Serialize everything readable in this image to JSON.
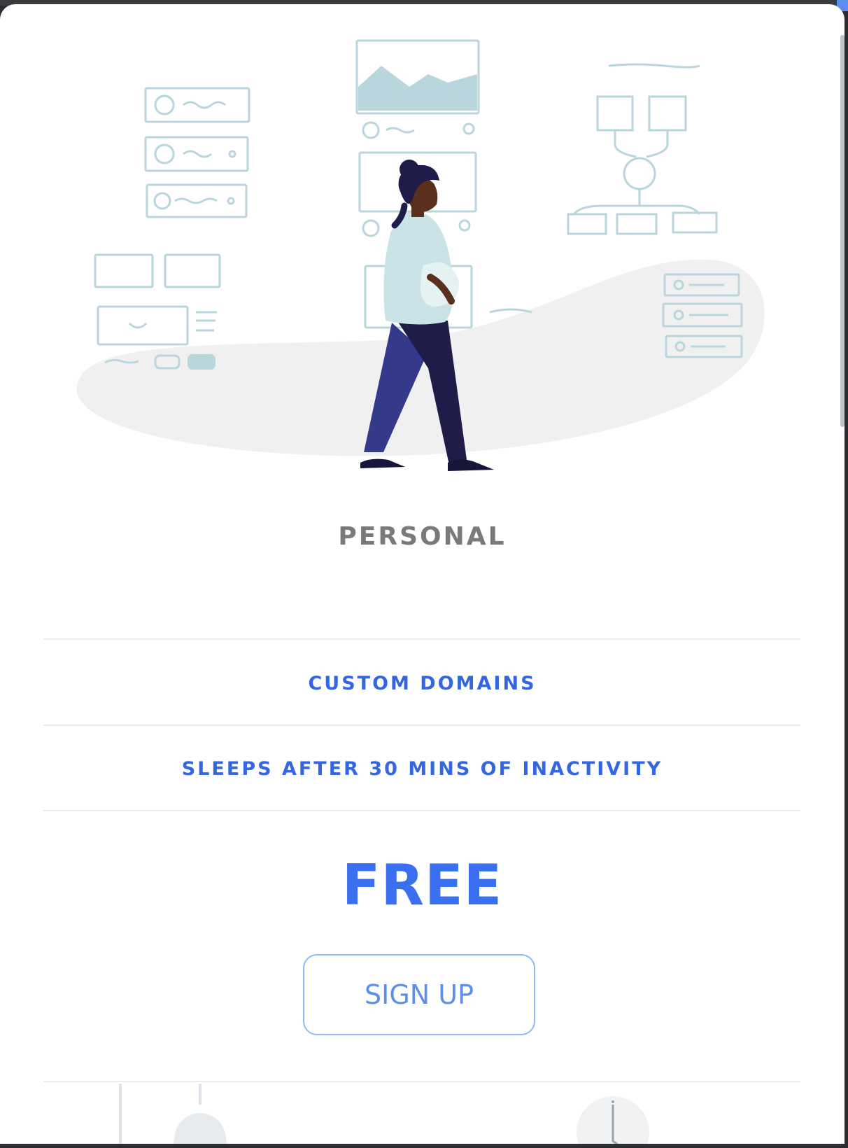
{
  "plan": {
    "name": "PERSONAL",
    "features": [
      "CUSTOM DOMAINS",
      "SLEEPS AFTER 30 MINS OF INACTIVITY"
    ],
    "price": "FREE",
    "cta_label": "SIGN UP"
  },
  "colors": {
    "accent": "#3a6ff0",
    "feature_text": "#3366e0",
    "title_text": "#7a7a7a",
    "button_border": "#8fbaf5",
    "divider": "#e5eef6"
  },
  "illustration": {
    "icon": "person-walking-illustration"
  }
}
